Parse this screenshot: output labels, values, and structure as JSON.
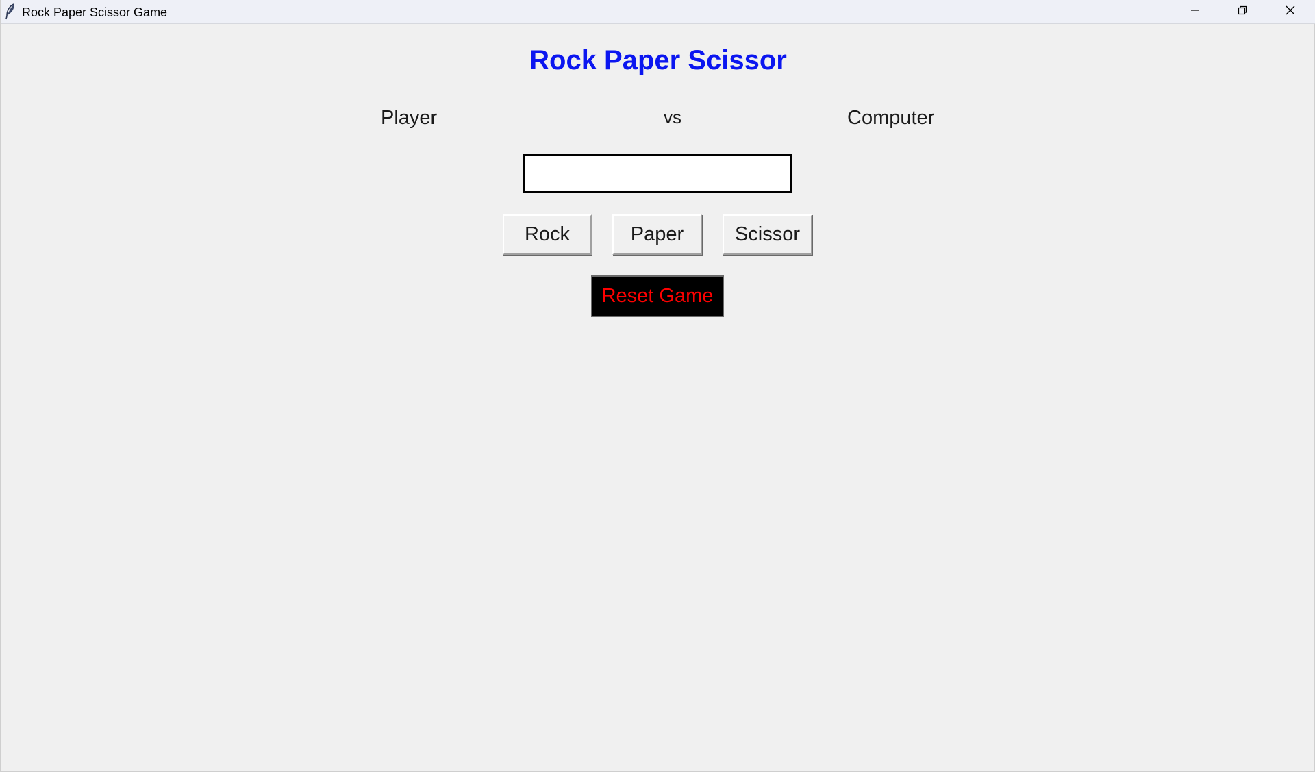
{
  "window": {
    "title": "Rock Paper Scissor Game",
    "icon": "feather-icon",
    "controls": [
      "minimize-icon",
      "restore-icon",
      "close-icon"
    ]
  },
  "app": {
    "heading": "Rock Paper Scissor",
    "player_label": "Player",
    "vs_label": "vs",
    "computer_label": "Computer",
    "result_value": "",
    "buttons": {
      "rock": "Rock",
      "paper": "Paper",
      "scissor": "Scissor",
      "reset": "Reset Game"
    }
  },
  "colors": {
    "heading": "#0b16f0",
    "reset_text": "#ff0000",
    "reset_background": "#000000",
    "window_background": "#f0f0f0"
  }
}
